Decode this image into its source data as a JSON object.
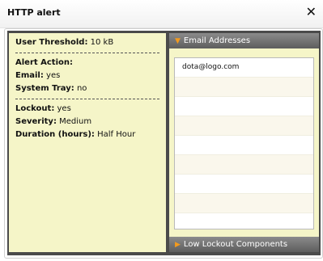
{
  "window": {
    "title": "HTTP alert",
    "close_glyph": "✕"
  },
  "details": {
    "threshold_label": "User Threshold:",
    "threshold_value": "10 kB",
    "alert_action_label": "Alert Action:",
    "email_label": "Email:",
    "email_value": "yes",
    "system_tray_label": "System Tray:",
    "system_tray_value": "no",
    "lockout_label": "Lockout:",
    "lockout_value": "yes",
    "severity_label": "Severity:",
    "severity_value": "Medium",
    "duration_label": "Duration (hours):",
    "duration_value": "Half Hour"
  },
  "email_panel": {
    "header": "Email Addresses",
    "arrow_icon": "chevron-down-icon",
    "rows": [
      "dota@logo.com",
      "",
      "",
      "",
      "",
      "",
      "",
      "",
      ""
    ]
  },
  "low_panel": {
    "header": "Low Lockout Components",
    "arrow_icon": "chevron-right-icon"
  },
  "colors": {
    "panel_bg": "#f5f5c8",
    "dark_frame": "#4a4a4a",
    "header_bg": "#6f6f6f",
    "arrow": "#f29a1e"
  }
}
